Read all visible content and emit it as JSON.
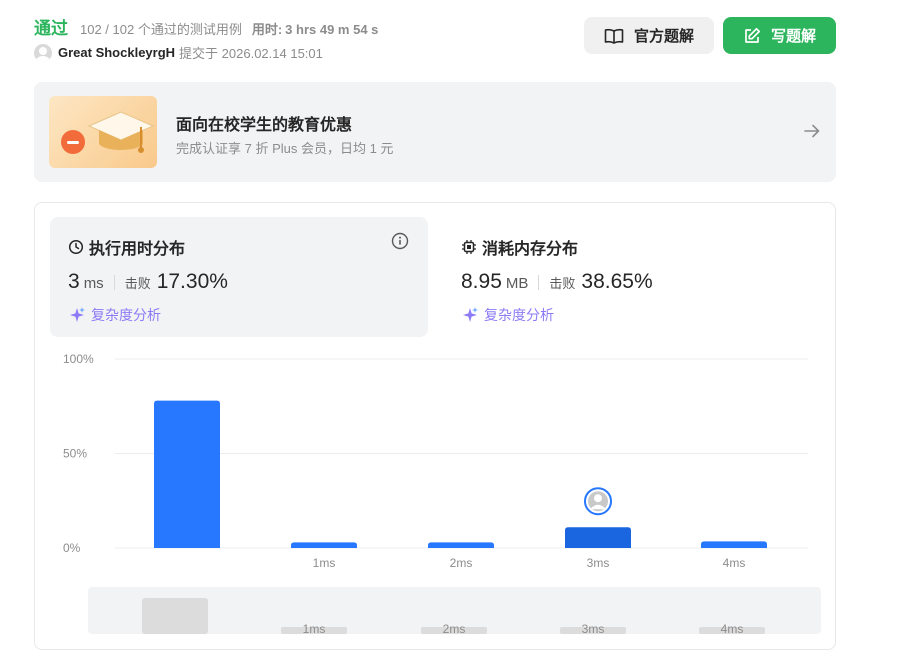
{
  "header": {
    "status": "通过",
    "passed": "102 / 102 个通过的测试用例",
    "time_label": "用时:",
    "time_value": "3 hrs 49 m 54 s",
    "user_name": "Great ShockleyrgH",
    "submitted": "提交于 2026.02.14 15:01",
    "btn_official": "官方题解",
    "btn_write": "写题解"
  },
  "banner": {
    "title": "面向在校学生的教育优惠",
    "subtitle": "完成认证享 7 折 Plus 会员，日均 1 元"
  },
  "runtime": {
    "title": "执行用时分布",
    "value": "3",
    "unit": "ms",
    "beat_label": "击败",
    "beat_value": "17.30%",
    "link": "复杂度分析"
  },
  "memory": {
    "title": "消耗内存分布",
    "value": "8.95",
    "unit": "MB",
    "beat_label": "击败",
    "beat_value": "38.65%",
    "link": "复杂度分析"
  },
  "colors": {
    "green": "#2db55d",
    "bar": "#2878ff",
    "bar_highlight": "#1a66e0",
    "purple": "#8b7cf6"
  },
  "chart_data": {
    "type": "bar",
    "y_ticks": [
      "100%",
      "50%",
      "0%"
    ],
    "ylim": [
      0,
      100
    ],
    "categories": [
      "",
      "1ms",
      "2ms",
      "3ms",
      "4ms"
    ],
    "values": [
      78,
      3,
      3,
      11,
      3.5
    ],
    "highlight_index": 3,
    "overview_labels": [
      "1ms",
      "2ms",
      "3ms",
      "4ms"
    ]
  }
}
